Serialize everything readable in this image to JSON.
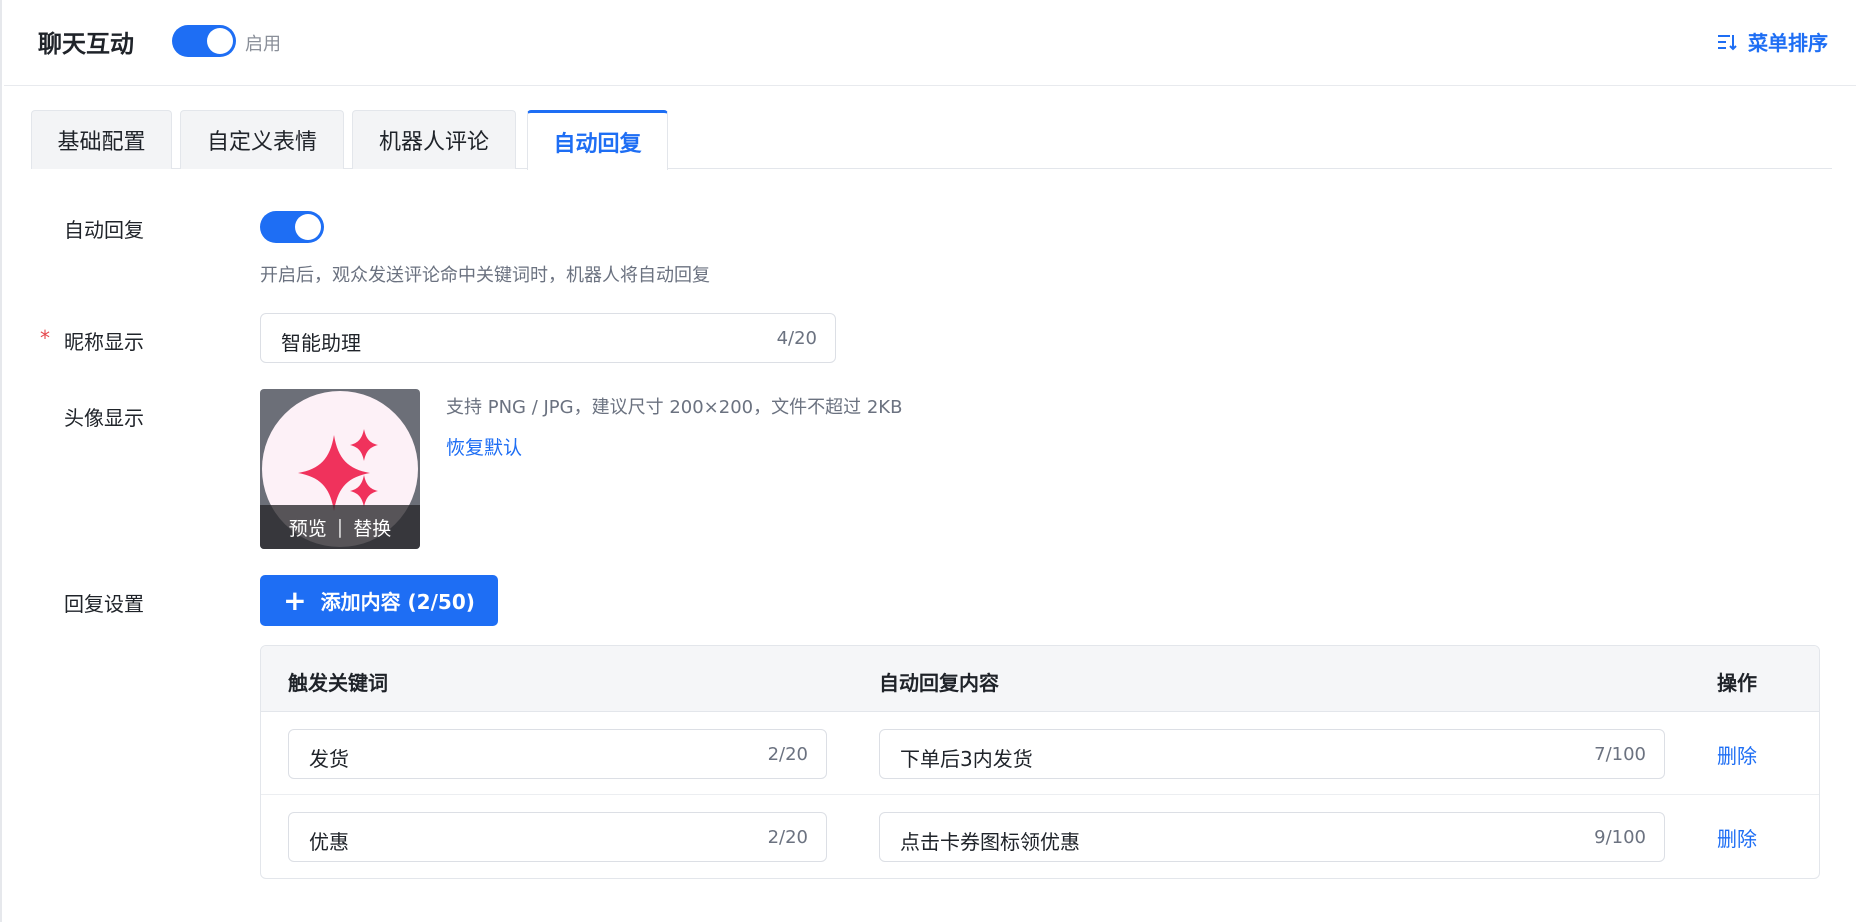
{
  "header": {
    "title": "聊天互动",
    "toggle_label": "启用",
    "toggle_on": true,
    "sort_label": "菜单排序"
  },
  "tabs": [
    {
      "label": "基础配置"
    },
    {
      "label": "自定义表情"
    },
    {
      "label": "机器人评论"
    },
    {
      "label": "自动回复",
      "active": true
    }
  ],
  "form": {
    "auto_reply": {
      "label": "自动回复",
      "on": true,
      "hint": "开启后，观众发送评论命中关键词时，机器人将自动回复"
    },
    "nickname": {
      "required_mark": "*",
      "label": "昵称显示",
      "value": "智能助理",
      "count": "4/20"
    },
    "avatar": {
      "label": "头像显示",
      "preview": "预览",
      "separator": "|",
      "replace": "替换",
      "hint": "支持 PNG / JPG，建议尺寸 200×200，文件不超过 2KB",
      "reset": "恢复默认",
      "icon": "sparkles-icon",
      "icon_color": "#f0325c"
    },
    "reply_settings": {
      "label": "回复设置",
      "add_button": "添加内容 (2/50)"
    }
  },
  "table": {
    "headers": {
      "keyword": "触发关键词",
      "content": "自动回复内容",
      "action": "操作"
    },
    "rows": [
      {
        "keyword": "发货",
        "keyword_count": "2/20",
        "content": "下单后3内发货",
        "content_count": "7/100",
        "action": "删除"
      },
      {
        "keyword": "优惠",
        "keyword_count": "2/20",
        "content": "点击卡券图标领优惠",
        "content_count": "9/100",
        "action": "删除"
      }
    ]
  },
  "colors": {
    "accent": "#1e6ef4",
    "required": "#e5484d"
  }
}
